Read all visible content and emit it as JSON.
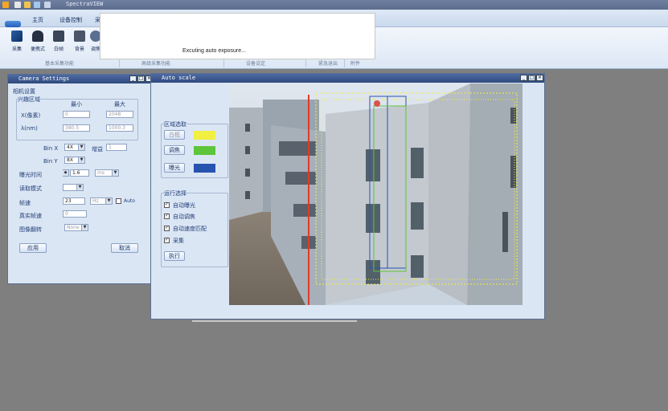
{
  "app": {
    "title": "SpectraVIEW"
  },
  "ribbon": {
    "tabs": [
      "主页",
      "设备控制",
      "采"
    ],
    "buttons": [
      {
        "label": "采集",
        "icon": "acquire-icon"
      },
      {
        "label": "便携式",
        "icon": "camera-icon"
      },
      {
        "label": "白帧",
        "icon": "white-frame-icon"
      },
      {
        "label": "背景",
        "icon": "background-icon"
      },
      {
        "label": "调焦",
        "icon": "focus-icon"
      }
    ],
    "groups": [
      "基本采集功能",
      "高级采集功能",
      "设备设定",
      "紧急退出",
      "附件"
    ]
  },
  "progress": {
    "message": "Excuting auto exposure..."
  },
  "camera_settings": {
    "title": "Camera Settings",
    "section_title": "相机设置",
    "roi_group": "兴趣区域",
    "col_min": "最小",
    "col_max": "最大",
    "row_x_label": "X(像素)",
    "row_x_min": "0",
    "row_x_max": "2048",
    "row_lambda_label": "λ(nm)",
    "row_lambda_min": "380.5",
    "row_lambda_max": "1000.3",
    "bin_x_label": "Bin X",
    "bin_x_value": "4X",
    "gain_label": "增益",
    "gain_value": "1",
    "bin_y_label": "Bin Y",
    "bin_y_value": "8X",
    "exposure_label": "曝光时间",
    "exposure_value": "1.6",
    "exposure_unit": "ms",
    "readout_label": "读取模式",
    "readout_value": "",
    "framerate_label": "帧速",
    "framerate_value": "23",
    "framerate_unit": "Hz",
    "auto_label": "Auto",
    "actual_fps_label": "真实帧速",
    "actual_fps_value": "0",
    "flip_label": "图像翻转",
    "flip_value": "None",
    "apply_label": "应用",
    "cancel_label": "取消"
  },
  "auto_scale": {
    "title": "Auto scale",
    "region_group": "区域选取",
    "buttons": [
      {
        "label": "白框",
        "color": "#f1ef42"
      },
      {
        "label": "调焦",
        "color": "#5cc53a"
      },
      {
        "label": "曝光",
        "color": "#2753b0"
      }
    ],
    "run_group": "运行选择",
    "checks": [
      {
        "label": "自动曝光",
        "checked": true
      },
      {
        "label": "自动调焦",
        "checked": true
      },
      {
        "label": "自动速度匹配",
        "checked": true
      },
      {
        "label": "采集",
        "checked": true
      }
    ],
    "execute_label": "执行"
  },
  "colors": {
    "yellow_roi": "#f1ef42",
    "green_roi": "#5cc53a",
    "blue_roi": "#2753b0",
    "red_line": "#e23a2a"
  }
}
